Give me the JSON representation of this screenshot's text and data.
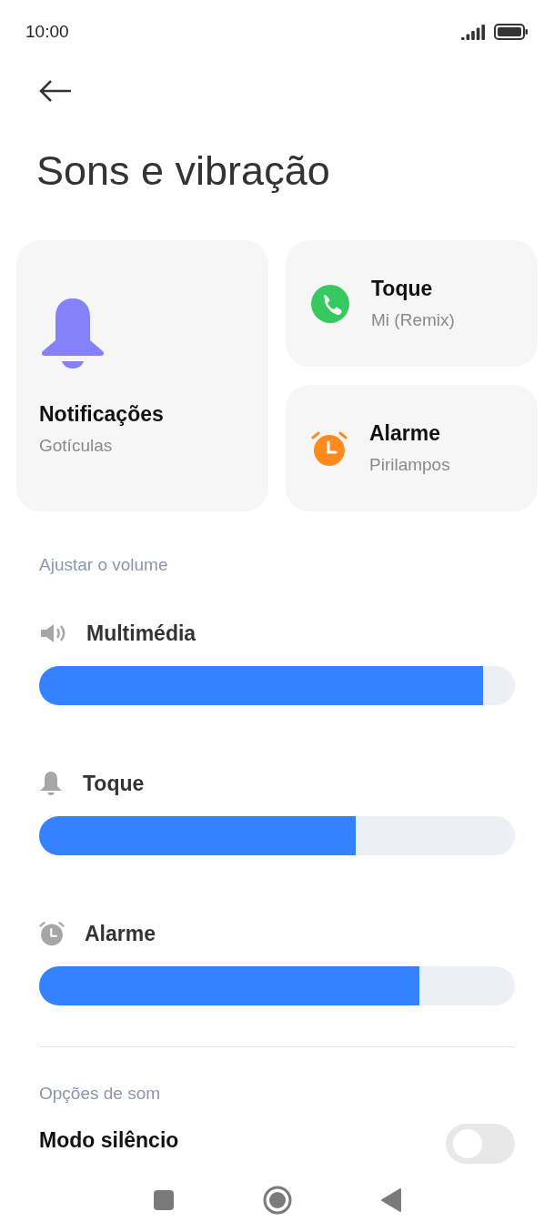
{
  "status_bar": {
    "time": "10:00"
  },
  "title": "Sons e vibração",
  "cards": [
    {
      "kind": "bell",
      "title": "Notificações",
      "subtitle": "Gotículas"
    },
    {
      "kind": "phone",
      "title": "Toque",
      "subtitle": "Mi (Remix)"
    },
    {
      "kind": "alarm",
      "title": "Alarme",
      "subtitle": "Pirilampos"
    }
  ],
  "volume_section": "Ajustar o volume",
  "channels": [
    {
      "kind": "speaker",
      "name": "Multimédia",
      "level": 0.933
    },
    {
      "kind": "bell",
      "name": "Toque",
      "level": 0.665
    },
    {
      "kind": "alarm",
      "name": "Alarme",
      "level": 0.8
    }
  ],
  "options_section": "Opções de som",
  "options": [
    {
      "label": "Modo silêncio",
      "on": false
    }
  ]
}
